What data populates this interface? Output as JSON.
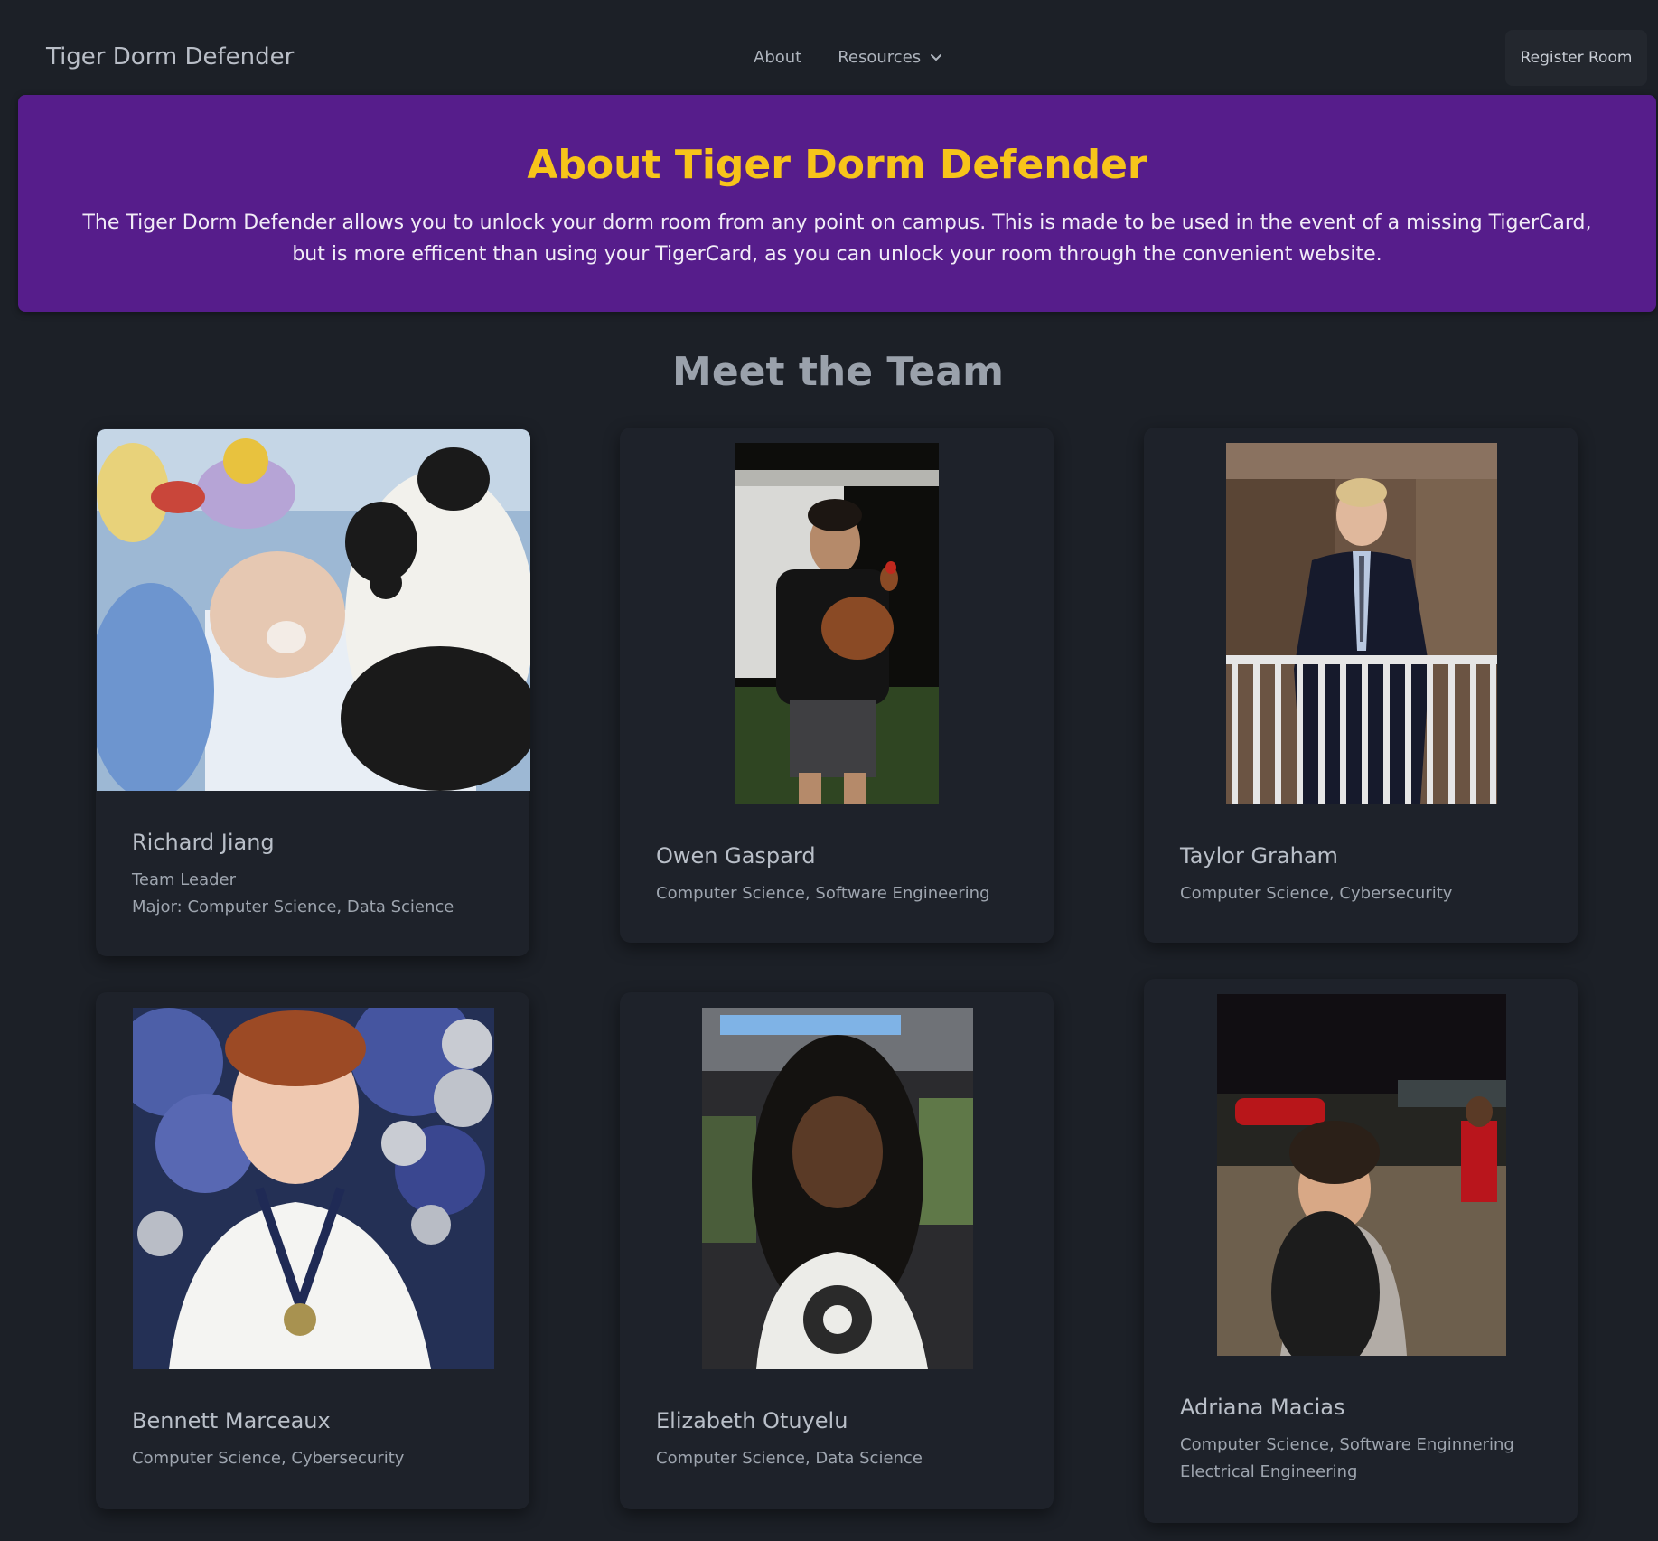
{
  "navbar": {
    "brand": "Tiger Dorm Defender",
    "links": {
      "about": "About",
      "resources": "Resources"
    },
    "register_button": "Register Room"
  },
  "hero": {
    "title": "About Tiger Dorm Defender",
    "description": "The Tiger Dorm Defender allows you to unlock your dorm room from any point on campus. This is made to be used in the event of a missing TigerCard, but is more efficent than using your TigerCard, as you can unlock your room through the convenient website.",
    "background_color": "#561d8b",
    "title_color": "#f7c41a"
  },
  "team": {
    "title": "Meet the Team",
    "members": [
      {
        "name": "Richard Jiang",
        "line1": "Team Leader",
        "line2": "Major: Computer Science, Data Science",
        "photo": "baby-with-stuffed-animals-photo"
      },
      {
        "name": "Owen Gaspard",
        "line1": "Computer Science, Software Engineering",
        "photo": "person-holding-chicken-photo"
      },
      {
        "name": "Taylor Graham",
        "line1": "Computer Science, Cybersecurity",
        "photo": "person-in-suit-at-railing-photo"
      },
      {
        "name": "Bennett Marceaux",
        "line1": "Computer Science, Cybersecurity",
        "photo": "person-with-medal-balloons-photo"
      },
      {
        "name": "Elizabeth Otuyelu",
        "line1": "Computer Science, Data Science",
        "photo": "selfie-in-car-photo"
      },
      {
        "name": "Adriana Macias",
        "line1": "Computer Science, Software Enginnering",
        "line2": "Electrical Engineering",
        "photo": "night-parking-lot-selfie-photo"
      }
    ]
  }
}
